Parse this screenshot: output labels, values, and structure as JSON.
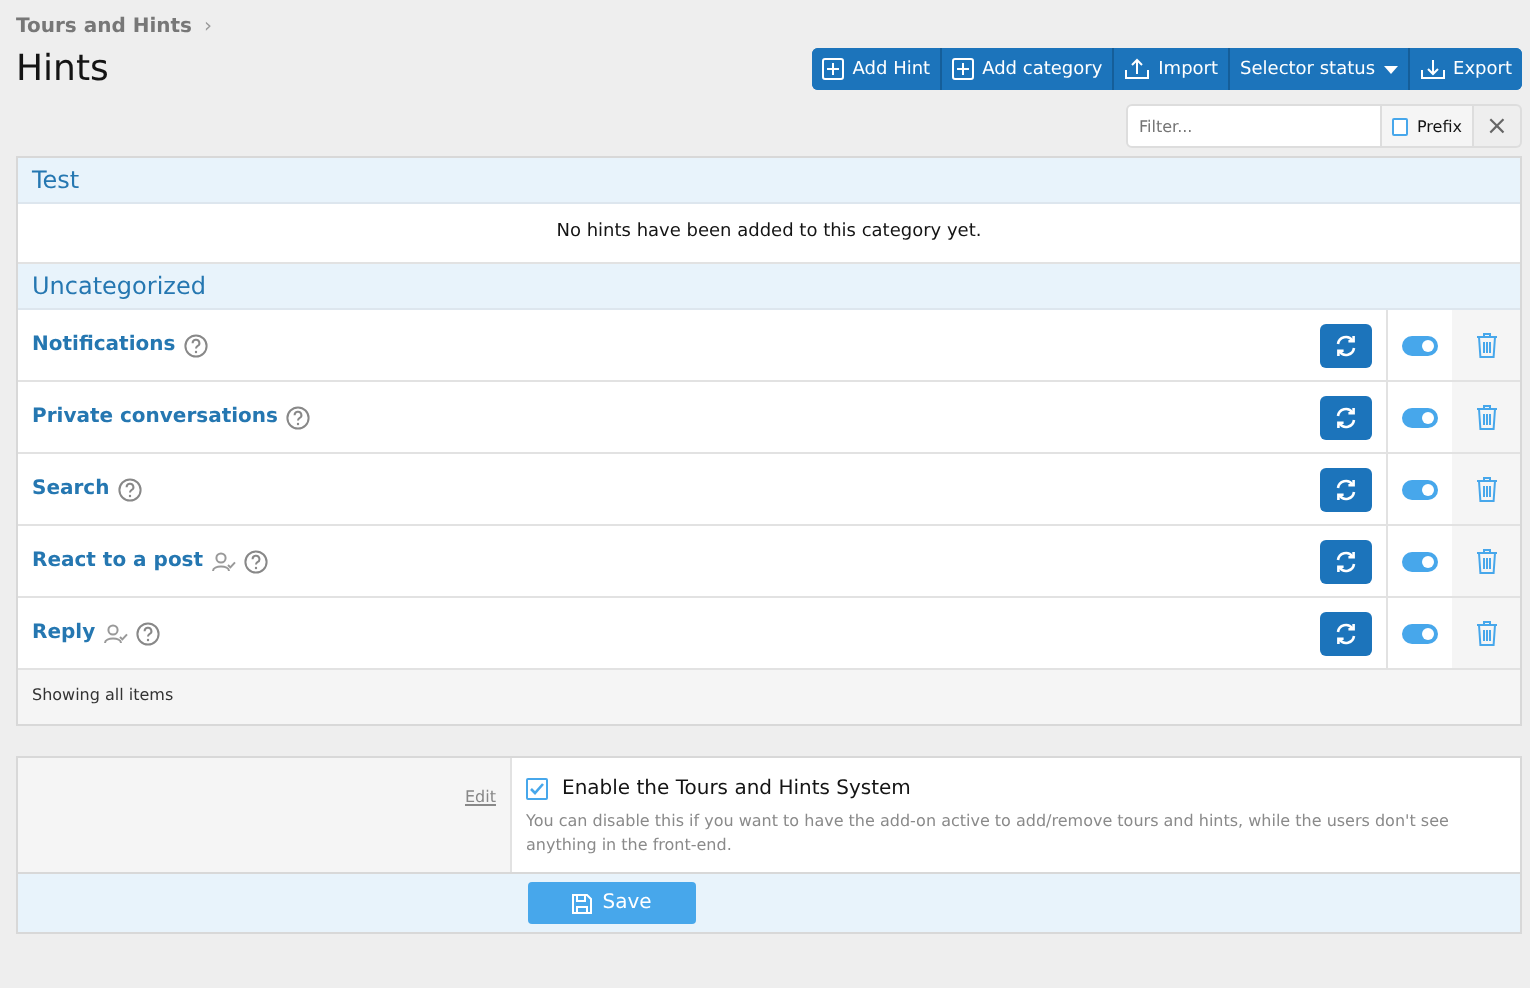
{
  "breadcrumb": {
    "label": "Tours and Hints",
    "separator": "›"
  },
  "title": "Hints",
  "toolbar": [
    {
      "kind": "add",
      "label": "Add Hint"
    },
    {
      "kind": "add",
      "label": "Add category"
    },
    {
      "kind": "import",
      "label": "Import"
    },
    {
      "kind": "dropdown",
      "label": "Selector status"
    },
    {
      "kind": "export",
      "label": "Export"
    }
  ],
  "filter": {
    "placeholder": "Filter...",
    "prefix_label": "Prefix",
    "prefix_checked": false,
    "clear": "×"
  },
  "categories": [
    {
      "title": "Test",
      "empty_message": "No hints have been added to this category yet."
    },
    {
      "title": "Uncategorized",
      "hints": [
        {
          "title": "Notifications",
          "user_restricted": false,
          "enabled": true
        },
        {
          "title": "Private conversations",
          "user_restricted": false,
          "enabled": true
        },
        {
          "title": "Search",
          "user_restricted": false,
          "enabled": true
        },
        {
          "title": "React to a post",
          "user_restricted": true,
          "enabled": true
        },
        {
          "title": "Reply",
          "user_restricted": true,
          "enabled": true
        }
      ]
    }
  ],
  "list_footer": "Showing all items",
  "option": {
    "edit_link": "Edit",
    "label": "Enable the Tours and Hints System",
    "checked": true,
    "hint": "You can disable this if you want to have the add-on active to add/remove tours and hints, while the users don't see anything in the front-end."
  },
  "save_button": "Save"
}
